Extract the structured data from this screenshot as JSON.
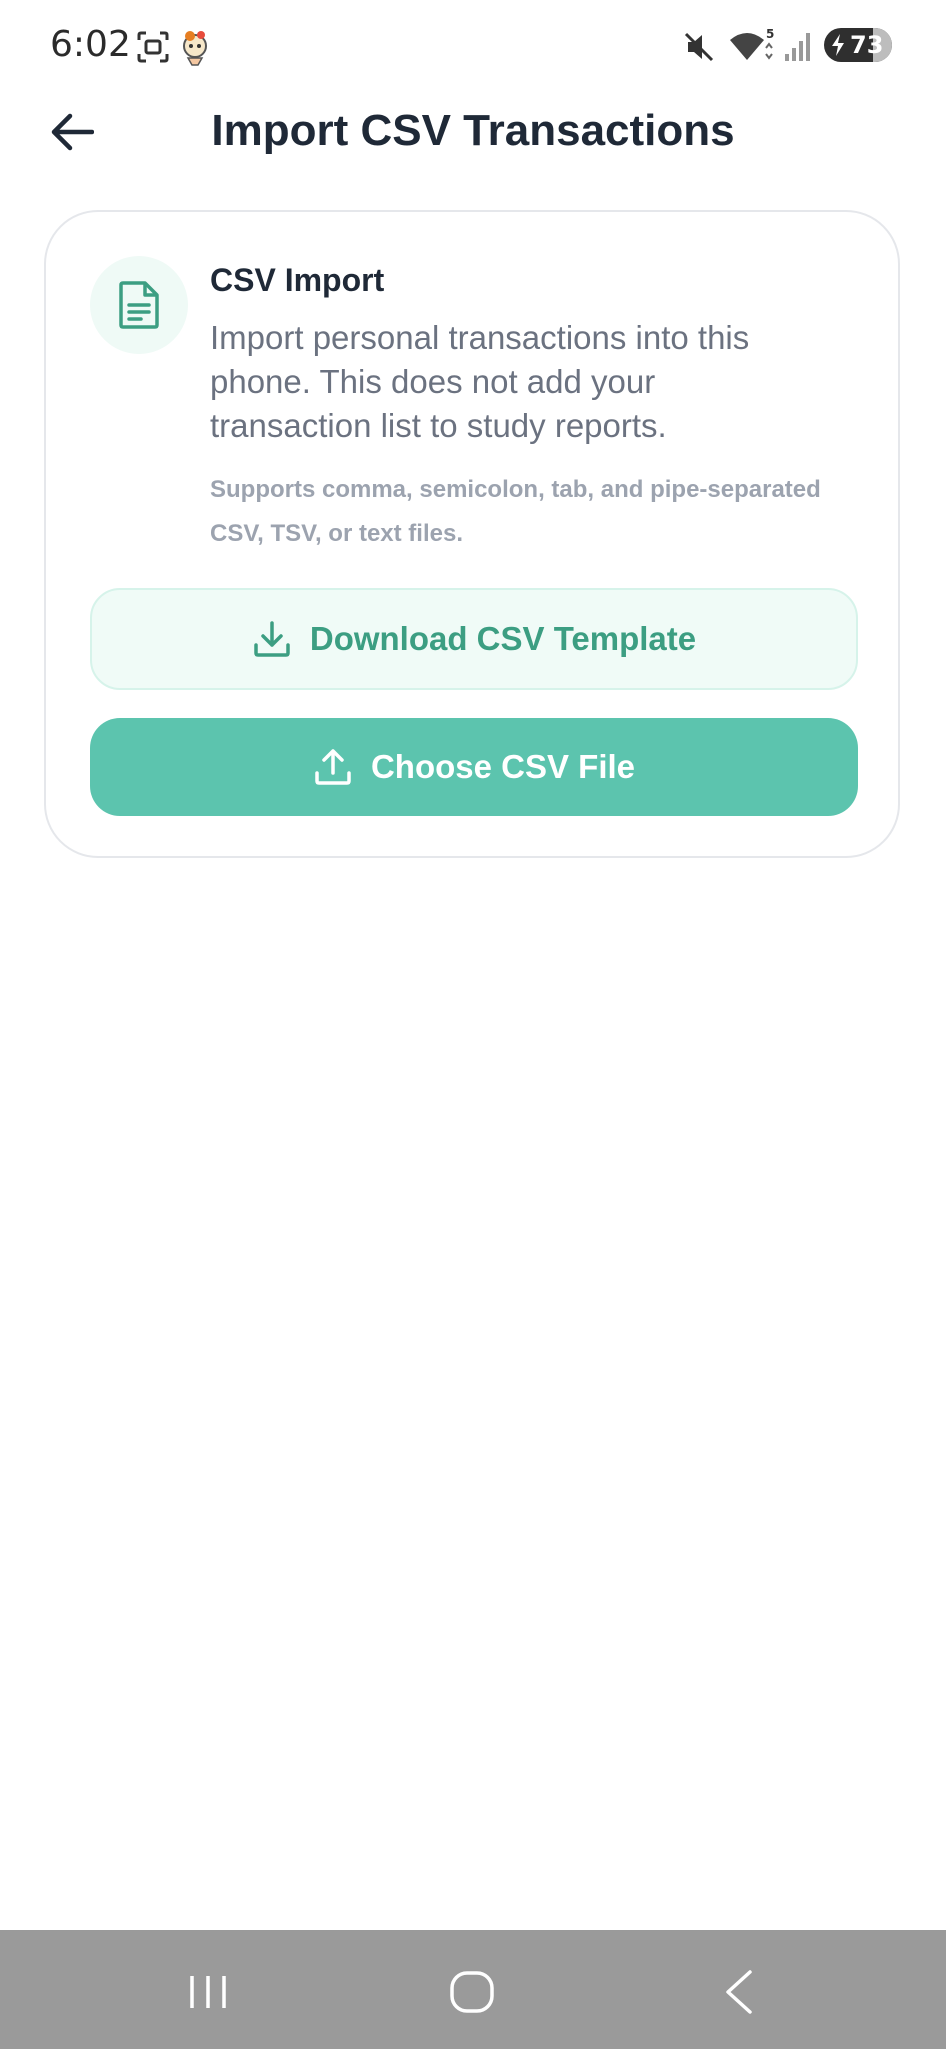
{
  "status_bar": {
    "time": "6:02",
    "battery_level": "73",
    "icons": [
      "screenshot-icon",
      "app-notification-icon",
      "mute-icon",
      "wifi-icon",
      "signal-icon",
      "battery-charging-icon"
    ]
  },
  "header": {
    "title": "Import CSV Transactions",
    "back_icon": "arrow-left-icon"
  },
  "card": {
    "icon": "document-icon",
    "title": "CSV Import",
    "description": "Import personal transactions into this phone. This does not add your transaction list to study reports.",
    "note": "Supports comma, semicolon, tab, and pipe-separated CSV, TSV, or text files.",
    "download_button_label": "Download CSV Template",
    "download_icon": "download-icon",
    "choose_button_label": "Choose CSV File",
    "choose_icon": "upload-icon"
  },
  "nav_bar": {
    "items": [
      "recents-icon",
      "home-icon",
      "back-icon"
    ]
  },
  "colors": {
    "accent": "#5cc4ae",
    "accent_dark": "#3c9e82",
    "accent_light_bg": "#f0fbf7",
    "nav_bar_bg": "#9a9a9a",
    "title_text": "#1f2937",
    "muted_text": "#6b7280"
  }
}
